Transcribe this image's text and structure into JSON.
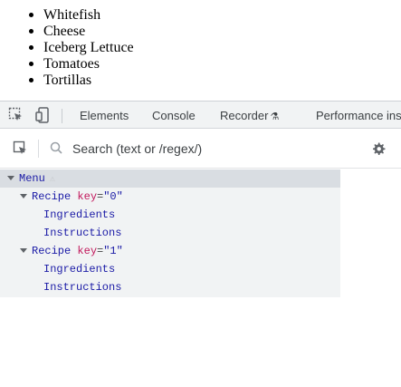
{
  "page": {
    "items": [
      "Whitefish",
      "Cheese",
      "Iceberg Lettuce",
      "Tomatoes",
      "Tortillas"
    ]
  },
  "devtools": {
    "tabs": [
      "Elements",
      "Console",
      "Recorder",
      "Performance ins"
    ],
    "search_placeholder": "Search (text or /regex/)",
    "tree": {
      "root": "Menu",
      "recipes": [
        {
          "name": "Recipe",
          "key_attr": "key",
          "key_value": "\"0\"",
          "children": [
            "Ingredients",
            "Instructions"
          ]
        },
        {
          "name": "Recipe",
          "key_attr": "key",
          "key_value": "\"1\"",
          "children": [
            "Ingredients",
            "Instructions"
          ]
        }
      ]
    },
    "icons": {
      "inspect": "inspect-element-icon",
      "device": "device-toolbar-icon",
      "flask": "experiment-flask-icon",
      "select": "select-component-icon",
      "search": "search-icon",
      "settings": "gear-icon",
      "warning": "warning-icon"
    }
  }
}
